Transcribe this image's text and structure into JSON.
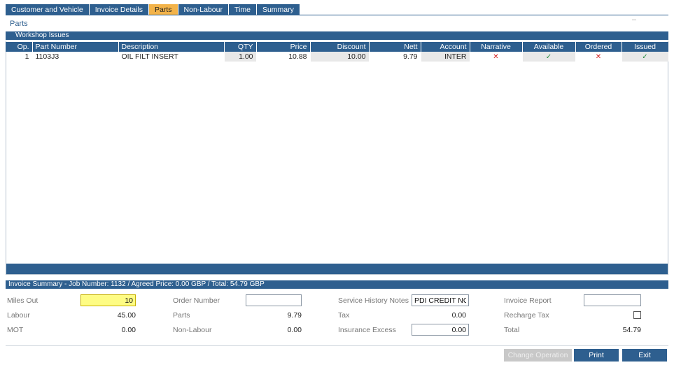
{
  "tabs": [
    "Customer and Vehicle",
    "Invoice Details",
    "Parts",
    "Non-Labour",
    "Time",
    "Summary"
  ],
  "active_tab": "Parts",
  "section_title": "Parts",
  "workshop_header": "Workshop Issues",
  "table": {
    "columns": [
      "Op.",
      "Part Number",
      "Description",
      "QTY",
      "Price",
      "Discount",
      "Nett",
      "Account",
      "Narrative",
      "Available",
      "Ordered",
      "Issued"
    ],
    "rows": [
      {
        "op": "1",
        "part_number": "1103J3",
        "description": "OIL FILT INSERT",
        "qty": "1.00",
        "price": "10.88",
        "discount": "10.00",
        "nett": "9.79",
        "account": "INTER",
        "narrative": "cross-icon",
        "available": "tick-icon",
        "ordered": "cross-icon",
        "issued": "tick-icon"
      }
    ]
  },
  "summary": {
    "header": "Invoice Summary - Job Number: 1132 / Agreed Price: 0.00 GBP / Total: 54.79 GBP",
    "miles_out_label": "Miles Out",
    "miles_out_value": "10",
    "order_number_label": "Order Number",
    "order_number_value": "",
    "service_history_label": "Service History Notes",
    "service_history_value": "PDI CREDIT NOTE",
    "invoice_report_label": "Invoice Report",
    "invoice_report_value": "",
    "labour_label": "Labour",
    "labour_value": "45.00",
    "parts_label": "Parts",
    "parts_value": "9.79",
    "tax_label": "Tax",
    "tax_value": "0.00",
    "recharge_tax_label": "Recharge Tax",
    "recharge_tax_checked": false,
    "mot_label": "MOT",
    "mot_value": "0.00",
    "non_labour_label": "Non-Labour",
    "non_labour_value": "0.00",
    "insurance_excess_label": "Insurance Excess",
    "insurance_excess_value": "0.00",
    "total_label": "Total",
    "total_value": "54.79"
  },
  "buttons": {
    "change_operation": "Change Operation",
    "print": "Print",
    "exit": "Exit"
  },
  "colors": {
    "header_blue": "#2e5f8f",
    "active_tab": "#f3b349",
    "highlight_yellow": "#fefc84",
    "cross_red": "#d32020",
    "tick_green": "#1f8a3a"
  }
}
